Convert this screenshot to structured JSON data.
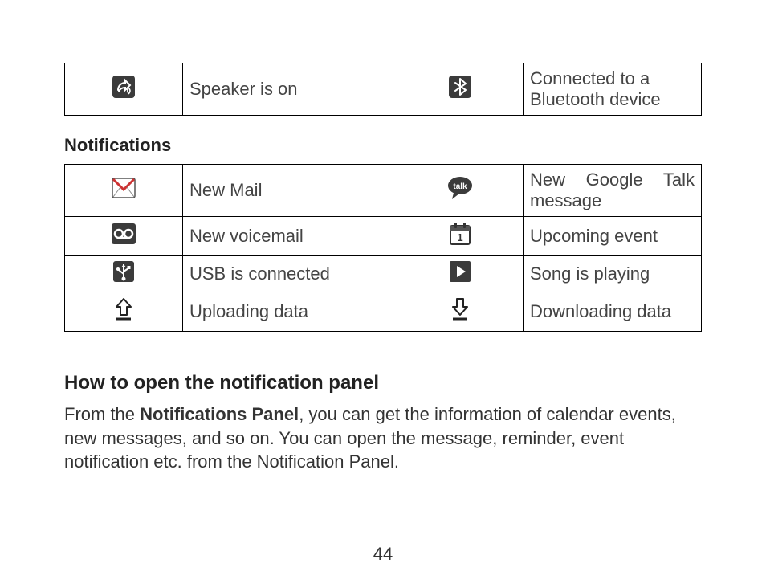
{
  "status_table": {
    "rows": [
      {
        "icon1": "speaker-icon",
        "label1": "Speaker is on",
        "icon2": "bluetooth-icon",
        "label2": "Connected to a Bluetooth device"
      }
    ]
  },
  "notifications_heading": "Notifications",
  "notifications_table": {
    "rows": [
      {
        "icon1": "mail-icon",
        "label1": "New Mail",
        "icon2": "talk-icon",
        "label2": "New Google Talk message"
      },
      {
        "icon1": "voicemail-icon",
        "label1": "New voicemail",
        "icon2": "calendar-icon",
        "label2": "Upcoming event"
      },
      {
        "icon1": "usb-icon",
        "label1": "USB is connected",
        "icon2": "play-icon",
        "label2": "Song is playing"
      },
      {
        "icon1": "upload-icon",
        "label1": "Uploading data",
        "icon2": "download-icon",
        "label2": "Downloading data"
      }
    ]
  },
  "howto_heading": "How to open the notification panel",
  "howto_body_pre": "From the ",
  "howto_body_bold": "Notifications Panel",
  "howto_body_post": ", you can get the information of calendar events, new messages, and so on. You can open the message, reminder, event notification etc. from the Notification Panel.",
  "page_number": "44"
}
